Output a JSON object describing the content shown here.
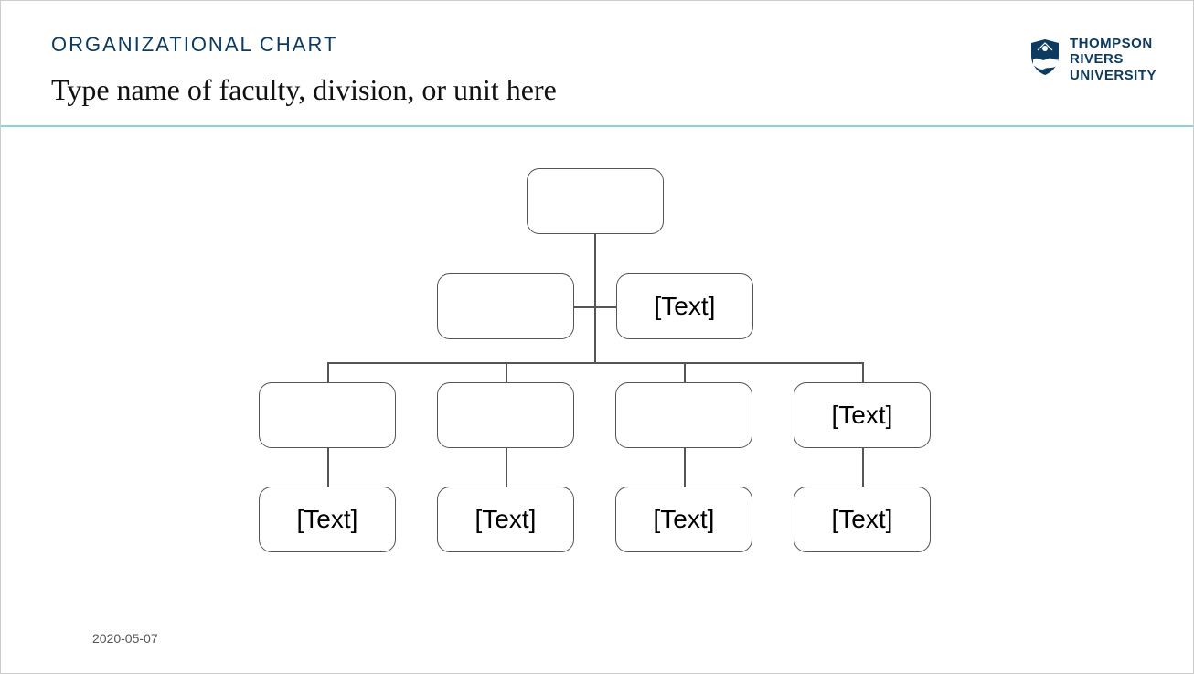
{
  "header": {
    "label": "ORGANIZATIONAL CHART",
    "subtitle": "Type name of faculty, division, or unit here"
  },
  "logo": {
    "line1": "THOMPSON",
    "line2": "RIVERS",
    "line3": "UNIVERSITY"
  },
  "nodes": {
    "root": "",
    "level2_left": "",
    "level2_right": "[Text]",
    "level3_1_top": "",
    "level3_2_top": "",
    "level3_3_top": "",
    "level3_4_top": "[Text]",
    "level3_1_bottom": "[Text]",
    "level3_2_bottom": "[Text]",
    "level3_3_bottom": "[Text]",
    "level3_4_bottom": "[Text]"
  },
  "footer": {
    "date": "2020-05-07"
  }
}
